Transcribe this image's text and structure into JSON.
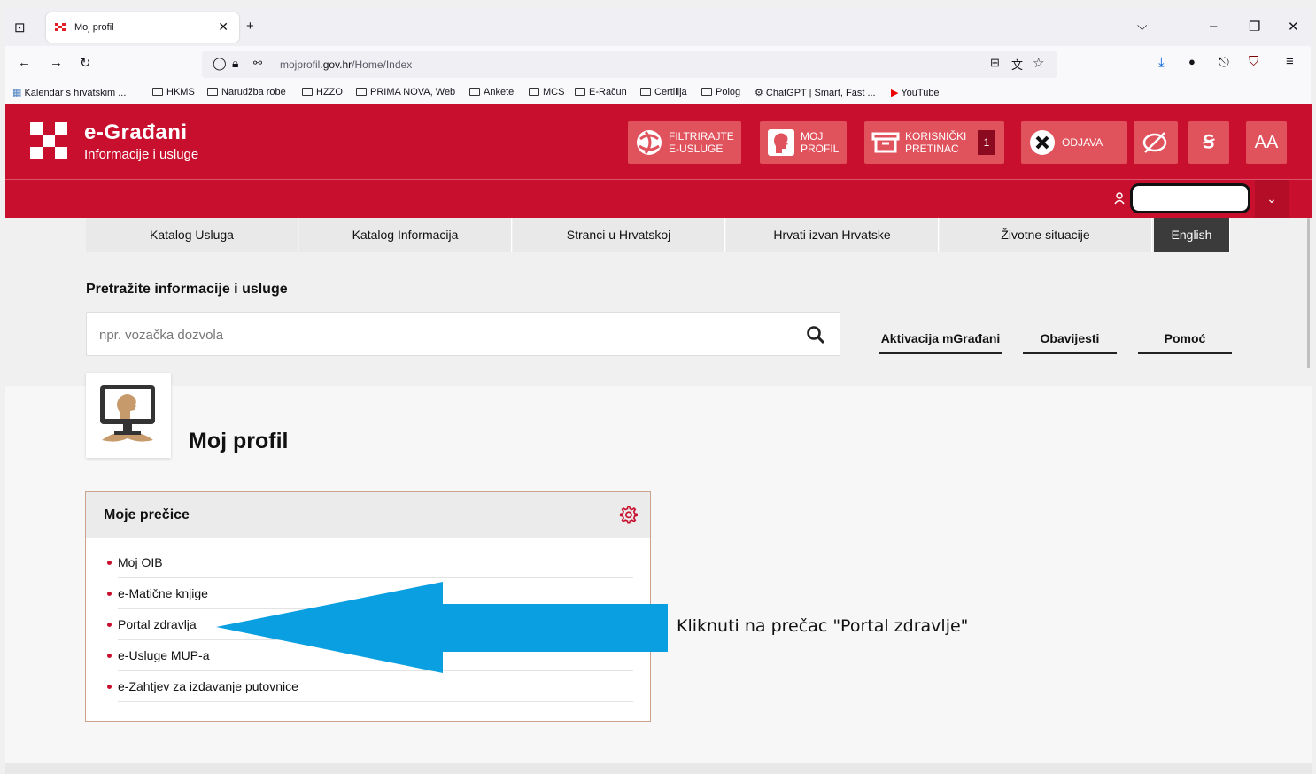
{
  "browser": {
    "tab_title": "Moj profil",
    "url_prefix": "mojprofil.",
    "url_domain": "gov.hr",
    "url_path": "/Home/Index",
    "bookmarks": [
      "Kalendar s hrvatskim ...",
      "HKMS",
      "Narudžba robe",
      "HZZO",
      "PRIMA NOVA, Web",
      "Ankete",
      "MCS",
      "E-Račun",
      "Certilija",
      "Polog",
      "ChatGPT | Smart, Fast ...",
      "YouTube"
    ]
  },
  "header": {
    "brand": "e-Građani",
    "subtitle": "Informacije i usluge",
    "filter_line1": "FILTRIRAJTE",
    "filter_line2": "E-USLUGE",
    "profile_line1": "MOJ",
    "profile_line2": "PROFIL",
    "inbox_line1": "KORISNIČKI",
    "inbox_line2": "PRETINAC",
    "inbox_count": "1",
    "logout": "ODJAVA",
    "dyslexia": "Ꞩ",
    "fontsize": "AA"
  },
  "nav": {
    "items": [
      "Katalog Usluga",
      "Katalog Informacija",
      "Stranci u Hrvatskoj",
      "Hrvati izvan Hrvatske",
      "Životne situacije"
    ],
    "lang": "English"
  },
  "search": {
    "label": "Pretražite informacije i usluge",
    "placeholder": "npr. vozačka dozvola"
  },
  "quick_links": [
    "Aktivacija mGrađani",
    "Obavijesti",
    "Pomoć"
  ],
  "page": {
    "title": "Moj profil"
  },
  "shortcuts": {
    "title": "Moje prečice",
    "items": [
      "Moj OIB",
      "e-Matične knjige",
      "Portal zdravlja",
      "e-Usluge MUP-a",
      "e-Zahtjev za izdavanje putovnice"
    ]
  },
  "annotation": "Kliknuti na prečac \"Portal zdravlje\"",
  "colors": {
    "brand_red": "#c8102e",
    "arrow_blue": "#0a9fe0"
  }
}
